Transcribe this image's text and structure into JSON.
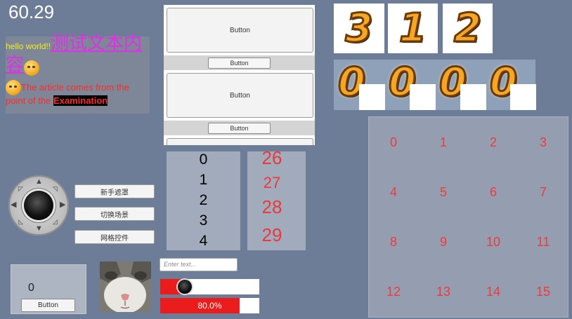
{
  "fps": "60.29",
  "rich_text": {
    "hello": "hello world!!",
    "chinese": "测试文本内容",
    "article": "The article comes from the point of the ",
    "exam": "Examination"
  },
  "scroll_panel": {
    "big_button_label": "Button",
    "small_button_label": "Button"
  },
  "digit_images": {
    "top": [
      "3",
      "1",
      "2"
    ],
    "bottom": [
      "0",
      "0",
      "0",
      "0"
    ]
  },
  "grid": [
    "0",
    "1",
    "2",
    "3",
    "4",
    "5",
    "6",
    "7",
    "8",
    "9",
    "10",
    "11",
    "12",
    "13",
    "14",
    "15"
  ],
  "list_a": [
    "0",
    "1",
    "2",
    "3",
    "4"
  ],
  "list_b": [
    "26",
    "27",
    "28",
    "29"
  ],
  "menu": {
    "guide": "新手遮罩",
    "switch_scene": "切换场景",
    "grid_control": "网格控件"
  },
  "counter": {
    "value": "0",
    "button": "Button"
  },
  "input": {
    "placeholder": "Enter text..."
  },
  "slider": {
    "value": 0.25
  },
  "progress": {
    "value": 0.8,
    "label": "80.0%"
  },
  "colors": {
    "accent": "#ea1c1c",
    "background": "#6d7d97",
    "magenta": "#e030e6",
    "yellow": "#f0f01a"
  },
  "icons": {
    "joystick": "joystick-icon",
    "emoji_smile": "smile-emoji-icon",
    "emoji_think": "think-emoji-icon"
  }
}
